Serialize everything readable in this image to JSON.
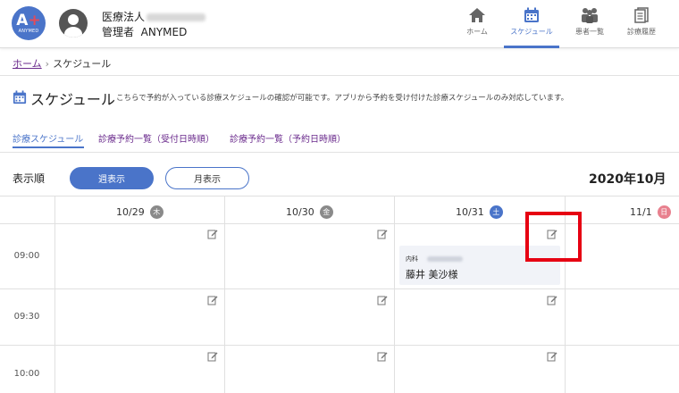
{
  "header": {
    "logo_text": "ANYMED",
    "org_name": "医療法人",
    "user_role": "管理者",
    "user_name": "ANYMED",
    "nav": [
      {
        "label": "ホーム",
        "icon": "home-icon"
      },
      {
        "label": "スケジュール",
        "icon": "calendar-icon"
      },
      {
        "label": "患者一覧",
        "icon": "patients-icon"
      },
      {
        "label": "診療履歴",
        "icon": "history-icon"
      }
    ]
  },
  "breadcrumb": {
    "home": "ホーム",
    "separator": "›",
    "current": "スケジュール"
  },
  "page": {
    "title": "スケジュール",
    "description": "こちらで予約が入っている診療スケジュールの確認が可能です。アプリから予約を受け付けた診療スケジュールのみ対応しています。"
  },
  "tabs": [
    "診療スケジュール",
    "診療予約一覧（受付日時順）",
    "診療予約一覧（予約日時順）"
  ],
  "view": {
    "sort_label": "表示順",
    "week_button": "週表示",
    "month_button": "月表示",
    "month_title": "2020年10月"
  },
  "days": [
    {
      "date": "10/29",
      "weekday": "木"
    },
    {
      "date": "10/30",
      "weekday": "金"
    },
    {
      "date": "10/31",
      "weekday": "土"
    },
    {
      "date": "11/1",
      "weekday": "日"
    }
  ],
  "times": [
    "09:00",
    "09:30",
    "10:00"
  ],
  "appointment": {
    "department": "内科",
    "patient": "藤井 美沙様"
  },
  "colors": {
    "primary": "#4a74c9",
    "link_purple": "#6a2a8c",
    "badge_gray": "#8a8a8a",
    "badge_sat": "#4a74c9",
    "badge_sun": "#e8808e",
    "highlight": "#e60012"
  }
}
